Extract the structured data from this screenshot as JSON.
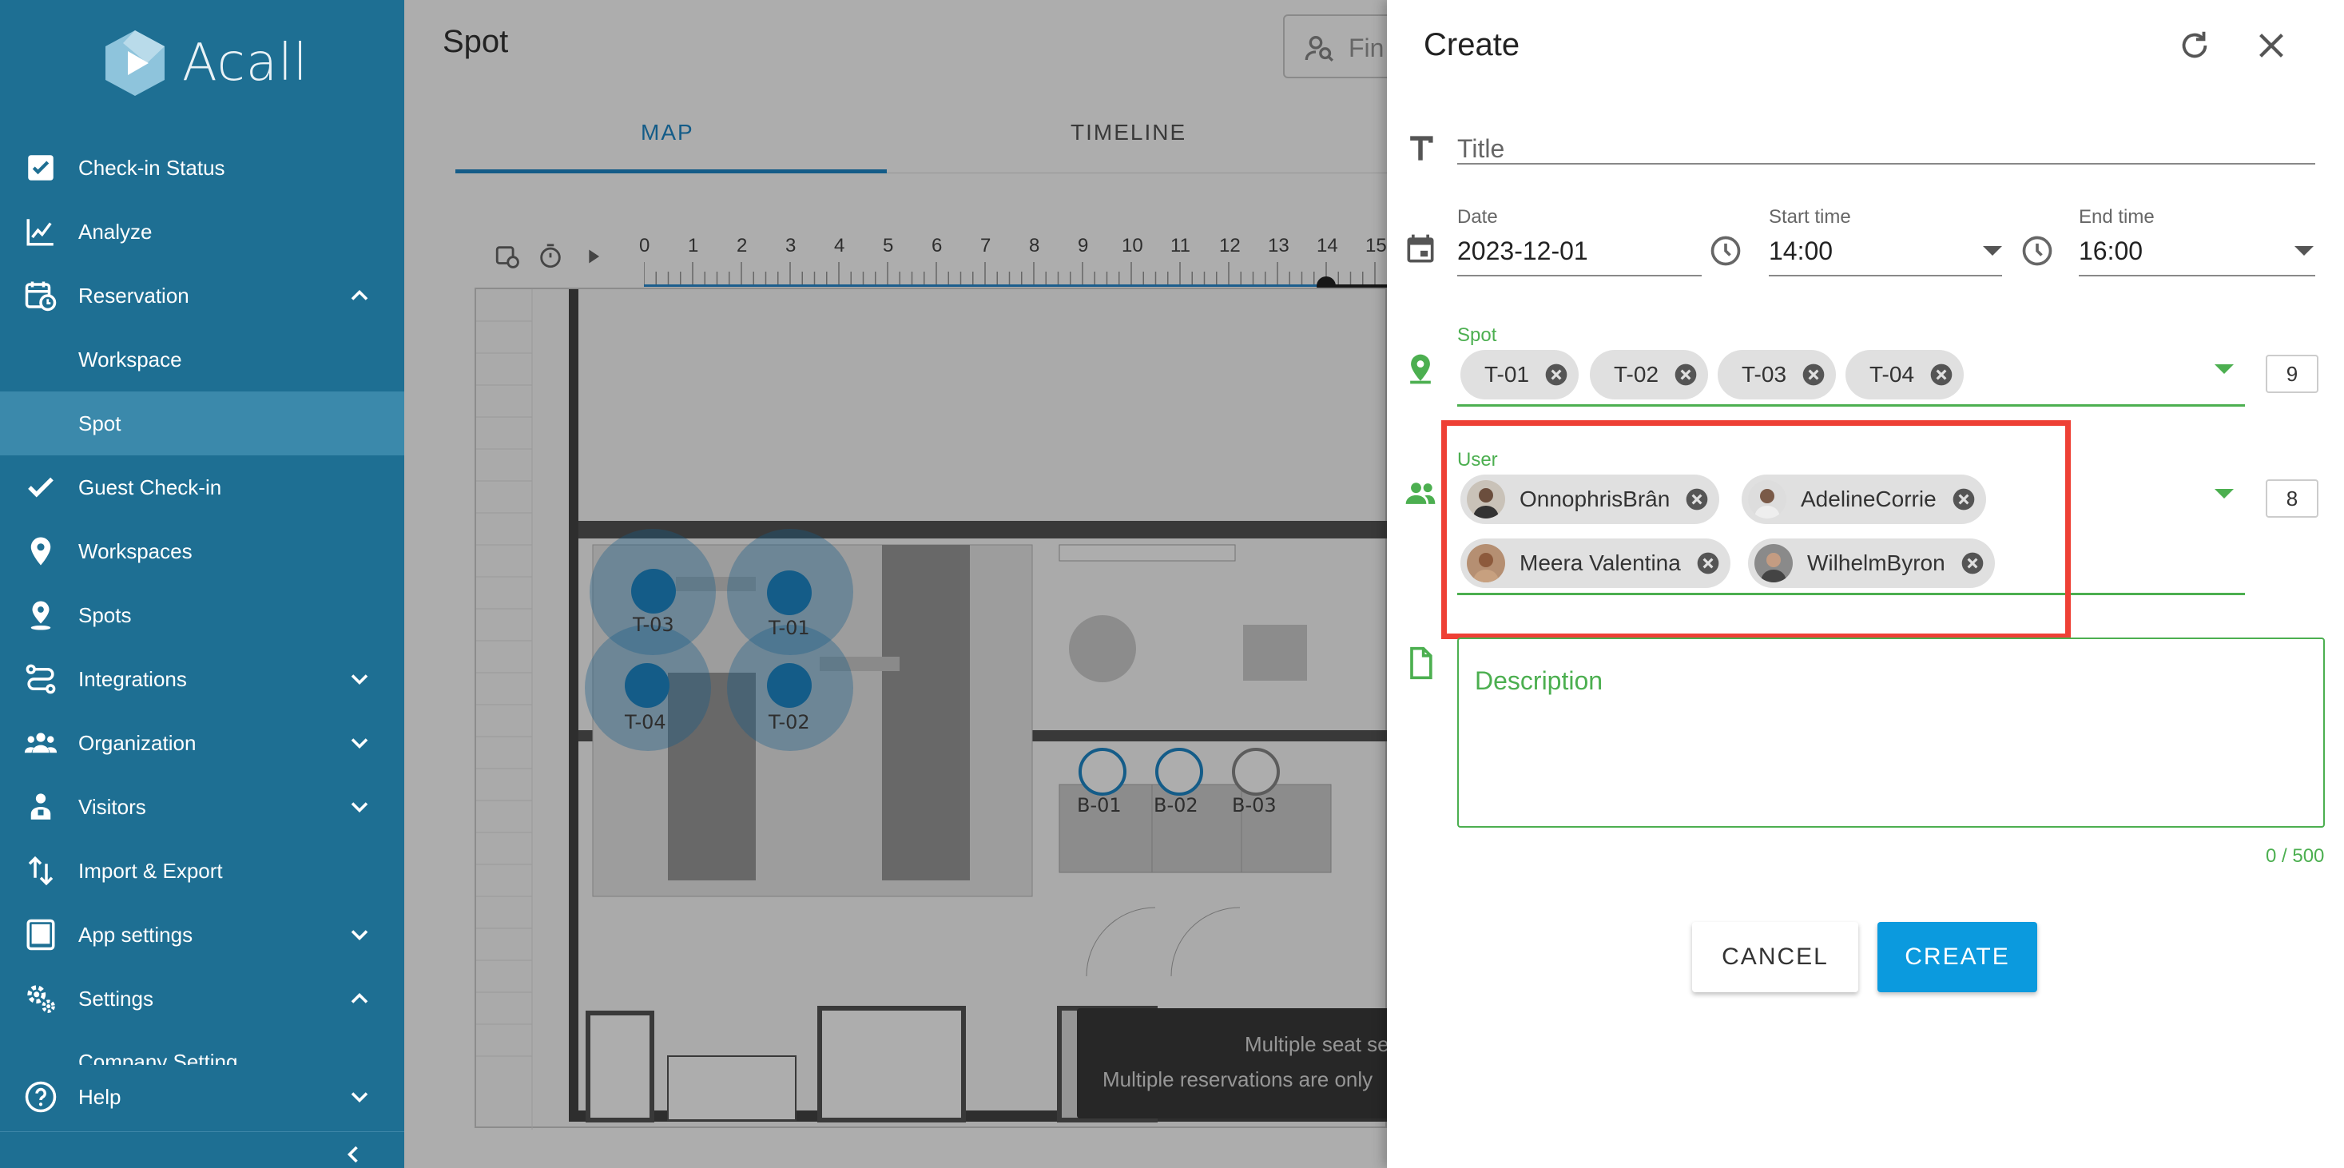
{
  "app": {
    "name": "Acall"
  },
  "sidebar": {
    "items": [
      {
        "label": "Check-in Status",
        "icon": "checkbox-icon",
        "expandable": false
      },
      {
        "label": "Analyze",
        "icon": "line-chart-icon",
        "expandable": false
      },
      {
        "label": "Reservation",
        "icon": "calendar-clock-icon",
        "expandable": true,
        "expanded": true
      },
      {
        "label": "Workspace",
        "icon": "",
        "sub": true
      },
      {
        "label": "Spot",
        "icon": "",
        "sub": true,
        "selected": true
      },
      {
        "label": "Guest Check-in",
        "icon": "check-icon",
        "expandable": false
      },
      {
        "label": "Workspaces",
        "icon": "location-pin-icon",
        "expandable": false
      },
      {
        "label": "Spots",
        "icon": "location-person-icon",
        "expandable": false
      },
      {
        "label": "Integrations",
        "icon": "integrations-icon",
        "expandable": true,
        "expanded": false
      },
      {
        "label": "Organization",
        "icon": "group-icon",
        "expandable": true,
        "expanded": false
      },
      {
        "label": "Visitors",
        "icon": "visitor-icon",
        "expandable": true,
        "expanded": false
      },
      {
        "label": "Import & Export",
        "icon": "import-export-icon",
        "expandable": false
      },
      {
        "label": "App settings",
        "icon": "tablet-icon",
        "expandable": true,
        "expanded": false
      },
      {
        "label": "Settings",
        "icon": "gears-icon",
        "expandable": true,
        "expanded": true
      },
      {
        "label": "Company Setting",
        "icon": "",
        "sub": true
      },
      {
        "label": "Help",
        "icon": "help-icon",
        "expandable": true,
        "expanded": false
      }
    ]
  },
  "main": {
    "title": "Spot",
    "search_placeholder": "Fin",
    "tabs": [
      {
        "label": "MAP",
        "active": true
      },
      {
        "label": "TIMELINE",
        "active": false
      }
    ],
    "hours": [
      "0",
      "1",
      "2",
      "3",
      "4",
      "5",
      "6",
      "7",
      "8",
      "9",
      "10",
      "11",
      "12",
      "13",
      "14",
      "15"
    ],
    "spots": [
      {
        "label": "T-03"
      },
      {
        "label": "T-01"
      },
      {
        "label": "T-04"
      },
      {
        "label": "T-02"
      },
      {
        "label": "B-01"
      },
      {
        "label": "B-02"
      },
      {
        "label": "B-03"
      }
    ],
    "toast": {
      "line1": "Multiple seat se",
      "line2": "Multiple reservations are only"
    }
  },
  "create_panel": {
    "title": "Create",
    "title_field": {
      "placeholder": "Title",
      "value": ""
    },
    "date": {
      "label": "Date",
      "value": "2023-12-01"
    },
    "start_time": {
      "label": "Start time",
      "value": "14:00"
    },
    "end_time": {
      "label": "End time",
      "value": "16:00"
    },
    "spot": {
      "label": "Spot",
      "chips": [
        "T-01",
        "T-02",
        "T-03",
        "T-04"
      ],
      "count": "9"
    },
    "user": {
      "label": "User",
      "chips": [
        "OnnophrisBrân",
        "AdelineCorrie",
        "Meera Valentina",
        "WilhelmByron"
      ],
      "count": "8"
    },
    "description": {
      "placeholder": "Description",
      "counter": "0 / 500"
    },
    "buttons": {
      "cancel": "CANCEL",
      "create": "CREATE"
    }
  },
  "colors": {
    "sidebar_bg": "#1e6f93",
    "accent_blue": "#0b9ade",
    "focus_green": "#4caf50",
    "highlight_red": "#ee4035"
  }
}
